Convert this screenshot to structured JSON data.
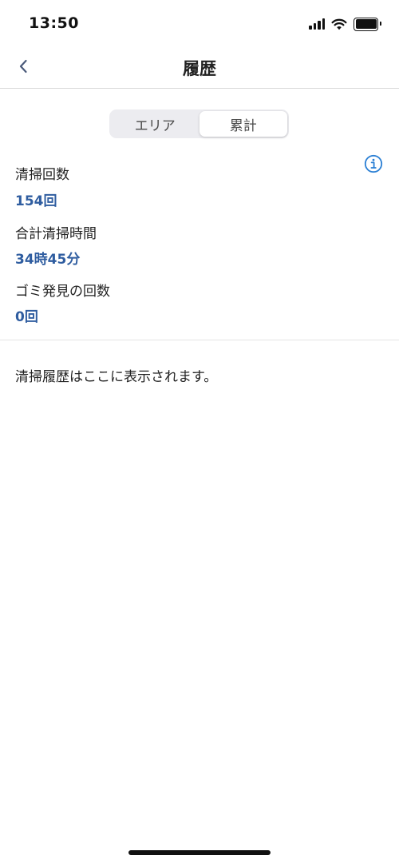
{
  "status_bar": {
    "time": "13:50",
    "icons": [
      "signal-icon",
      "wifi-icon",
      "battery-icon"
    ]
  },
  "nav": {
    "title": "履歴",
    "back_icon": "chevron-left-icon"
  },
  "segmented_control": {
    "tabs": [
      {
        "label": "エリア",
        "selected": false
      },
      {
        "label": "累計",
        "selected": true
      }
    ]
  },
  "info_icon": "info-icon",
  "stats": {
    "cleaning_count": {
      "label": "清掃回数",
      "value": "154回"
    },
    "total_cleaning_time": {
      "label": "合計清掃時間",
      "value": "34時45分"
    },
    "dirt_detection_count": {
      "label": "ゴミ発見の回数",
      "value": "0回"
    }
  },
  "history": {
    "placeholder": "清掃履歴はここに表示されます。"
  },
  "colors": {
    "accent": "#2f5da0",
    "nav_icon": "#4a5a7a",
    "info_icon": "#2a7fd4",
    "segment_bg": "#ececf0"
  }
}
